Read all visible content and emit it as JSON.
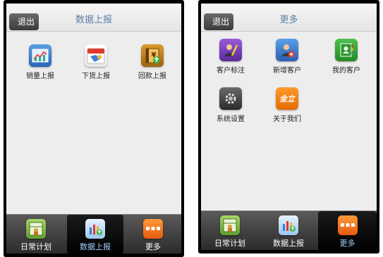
{
  "left": {
    "back_label": "退出",
    "title": "数据上报",
    "grid": [
      {
        "label": "销量上报",
        "icon": "sales-chart-icon"
      },
      {
        "label": "下货上报",
        "icon": "calendar-icon"
      },
      {
        "label": "回款上报",
        "icon": "payment-book-icon"
      }
    ],
    "tabs": [
      {
        "label": "日常计划",
        "icon": "daily-plan-icon"
      },
      {
        "label": "数据上报",
        "icon": "data-report-icon",
        "active": true
      },
      {
        "label": "更多",
        "icon": "more-icon"
      }
    ]
  },
  "right": {
    "back_label": "退出",
    "title": "更多",
    "grid": [
      {
        "label": "客户标注",
        "icon": "customer-mark-icon"
      },
      {
        "label": "新增客户",
        "icon": "add-customer-icon"
      },
      {
        "label": "我的客户",
        "icon": "my-customers-icon"
      },
      {
        "label": "系统设置",
        "icon": "settings-gear-icon"
      },
      {
        "label": "关于我们",
        "icon": "about-us-icon",
        "logo_text": "金立"
      }
    ],
    "tabs": [
      {
        "label": "日常计划",
        "icon": "daily-plan-icon"
      },
      {
        "label": "数据上报",
        "icon": "data-report-icon"
      },
      {
        "label": "更多",
        "icon": "more-icon",
        "active": true
      }
    ]
  },
  "colors": {
    "title": "#5a7fa8",
    "active_tab_label": "#9fd0ff"
  }
}
